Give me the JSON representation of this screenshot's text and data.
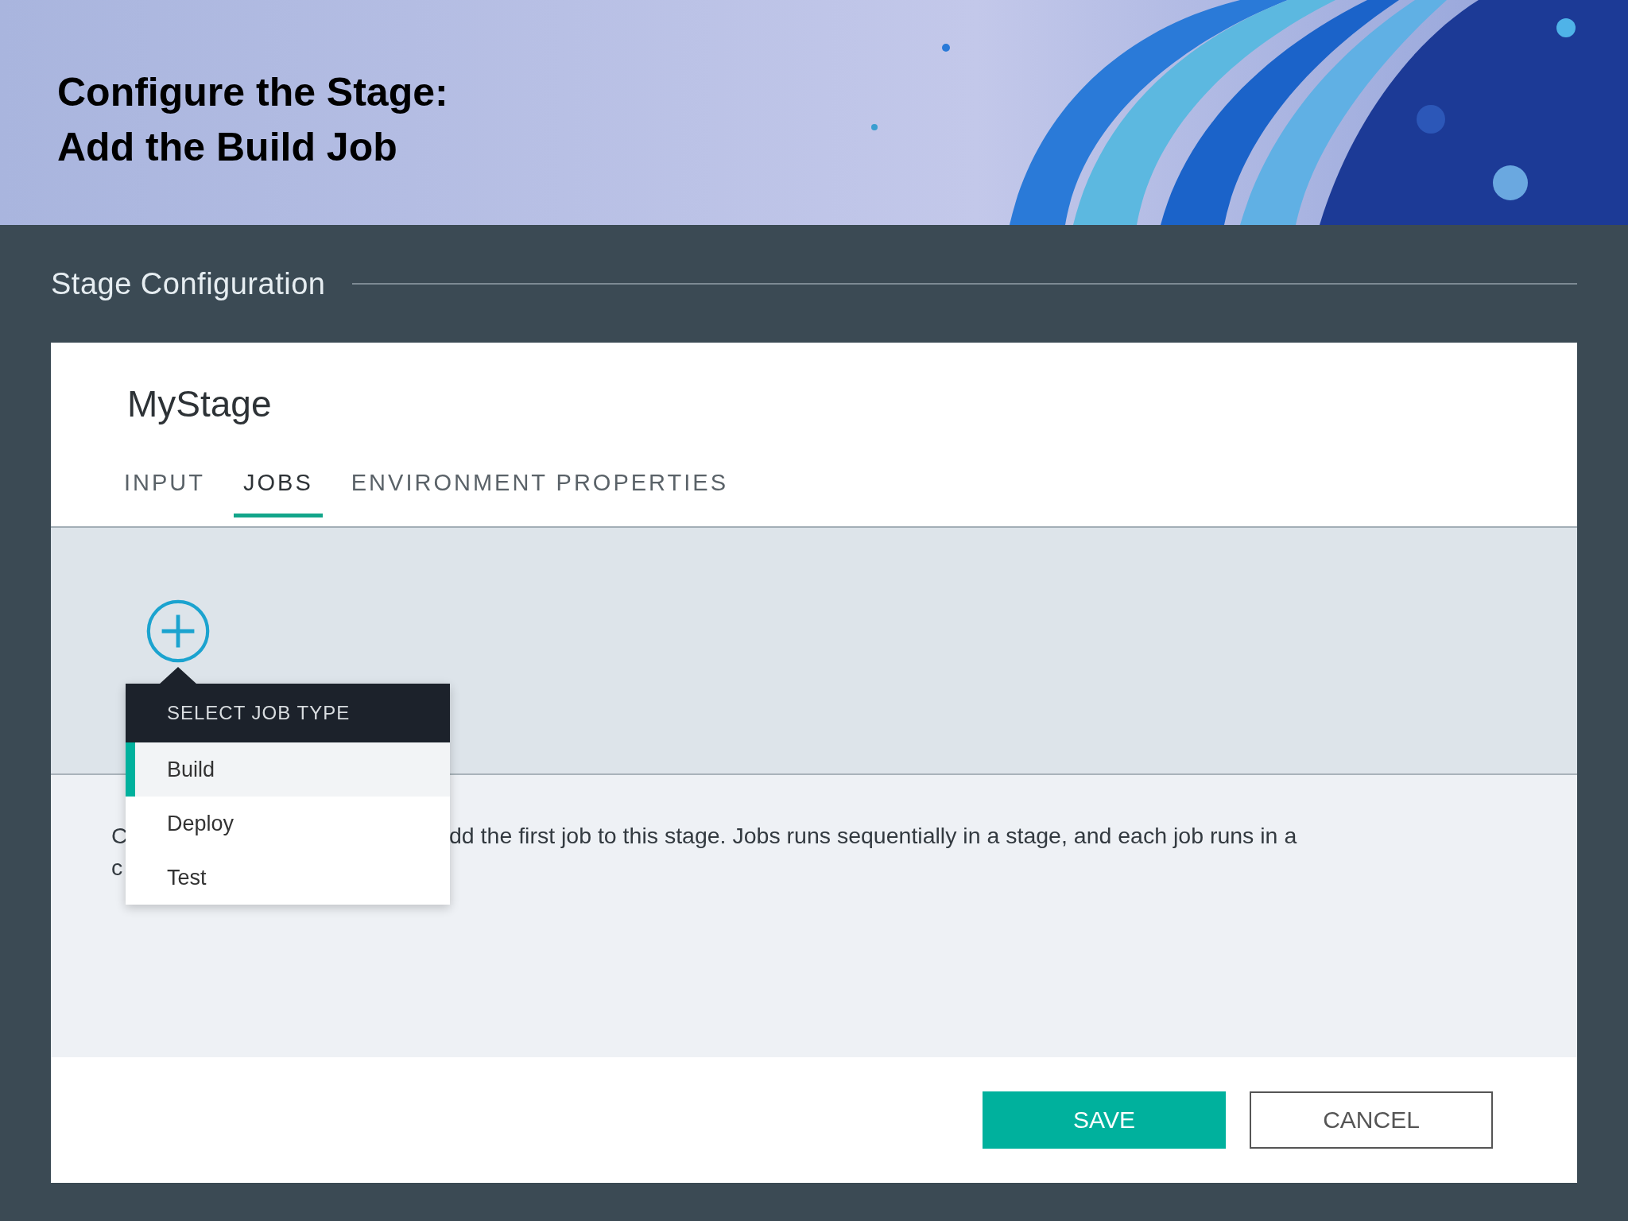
{
  "slide": {
    "title_lines": [
      "Configure the Stage:",
      "Add the Build Job"
    ]
  },
  "section": {
    "heading": "Stage Configuration"
  },
  "stage": {
    "name": "MyStage",
    "tabs": [
      {
        "label": "INPUT",
        "selected": false
      },
      {
        "label": "JOBS",
        "selected": true
      },
      {
        "label": "ENVIRONMENT PROPERTIES",
        "selected": false
      }
    ],
    "job_type_menu": {
      "header": "SELECT JOB TYPE",
      "items": [
        {
          "label": "Build",
          "selected": true
        },
        {
          "label": "Deploy",
          "selected": false
        },
        {
          "label": "Test",
          "selected": false
        }
      ]
    },
    "description": {
      "line_1_start": "C",
      "line_1_end": "dd the first job to this stage. Jobs runs sequentially in a stage, and each job runs in a",
      "line_2_start": "c"
    }
  },
  "buttons": [
    {
      "label": "SAVE",
      "kind": "primary"
    },
    {
      "label": "CANCEL",
      "kind": "secondary"
    }
  ]
}
